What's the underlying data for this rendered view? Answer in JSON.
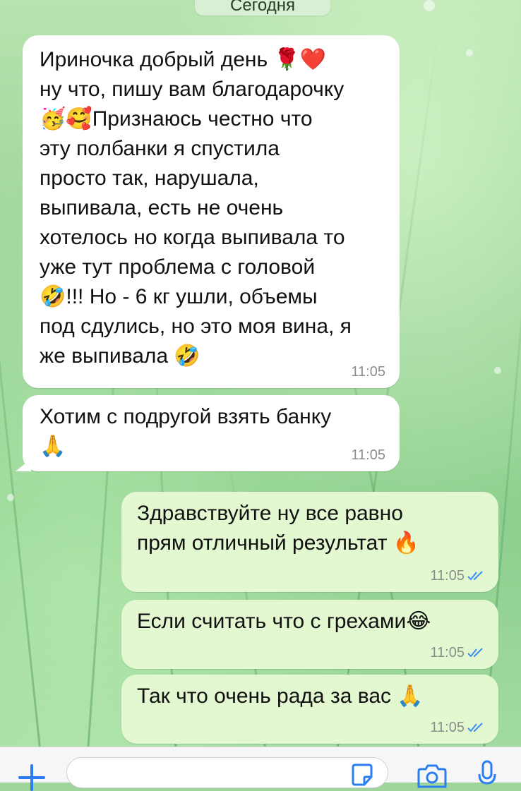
{
  "date_chip": "Сегодня",
  "messages": [
    {
      "direction": "incoming",
      "text": "Ириночка добрый день 🌹❤️\nну что, пишу вам благодарочку\n🥳🥰Признаюсь честно что\nэту полбанки я спустила\nпросто так, нарушала,\nвыпивала, есть не очень\nхотелось но когда выпивала то\nуже тут проблема с головой\n🤣!!! Но - 6 кг ушли, объемы\nпод сдулись, но это моя вина, я\nже выпивала 🤣",
      "time": "11:05"
    },
    {
      "direction": "incoming",
      "text": "Хотим с подругой взять банку\n🙏",
      "time": "11:05"
    },
    {
      "direction": "outgoing",
      "text": "Здравствуйте ну все равно\nпрям отличный результат 🔥",
      "time": "11:05"
    },
    {
      "direction": "outgoing",
      "text": "Если считать что с грехами😂",
      "time": "11:05"
    },
    {
      "direction": "outgoing",
      "text": "Так что очень рада за вас 🙏",
      "time": "11:05"
    }
  ],
  "input_bar": {
    "placeholder": "",
    "icons": [
      "plus-icon",
      "sticker-icon",
      "camera-icon",
      "microphone-icon"
    ]
  },
  "colors": {
    "incoming_bubble": "#ffffff",
    "outgoing_bubble": "#e3f8d1",
    "read_check": "#3b8ff0",
    "accent": "#2a7ef2"
  }
}
